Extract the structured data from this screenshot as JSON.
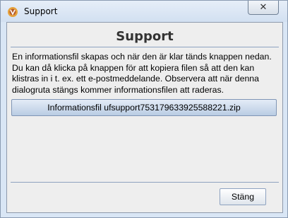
{
  "window": {
    "title": "Support",
    "close_glyph": "✕"
  },
  "dialog": {
    "heading": "Support",
    "info_text": "En informationsfil skapas och när den är klar tänds knappen nedan. Du kan då klicka på knappen för att kopiera filen så att den kan klistras in i t. ex. ett e-postmeddelande. Observera att när denna dialogruta stängs kommer informationsfilen att raderas.",
    "file_button_label": "Informationsfil ufsupport753179633925588221.zip",
    "close_button_label": "Stäng"
  },
  "icons": {
    "app": "app-logo-icon",
    "close": "close-icon"
  },
  "colors": {
    "accent": "#7f95b5",
    "titlebar": "#d9e6f5",
    "panel": "#eeeeee"
  }
}
